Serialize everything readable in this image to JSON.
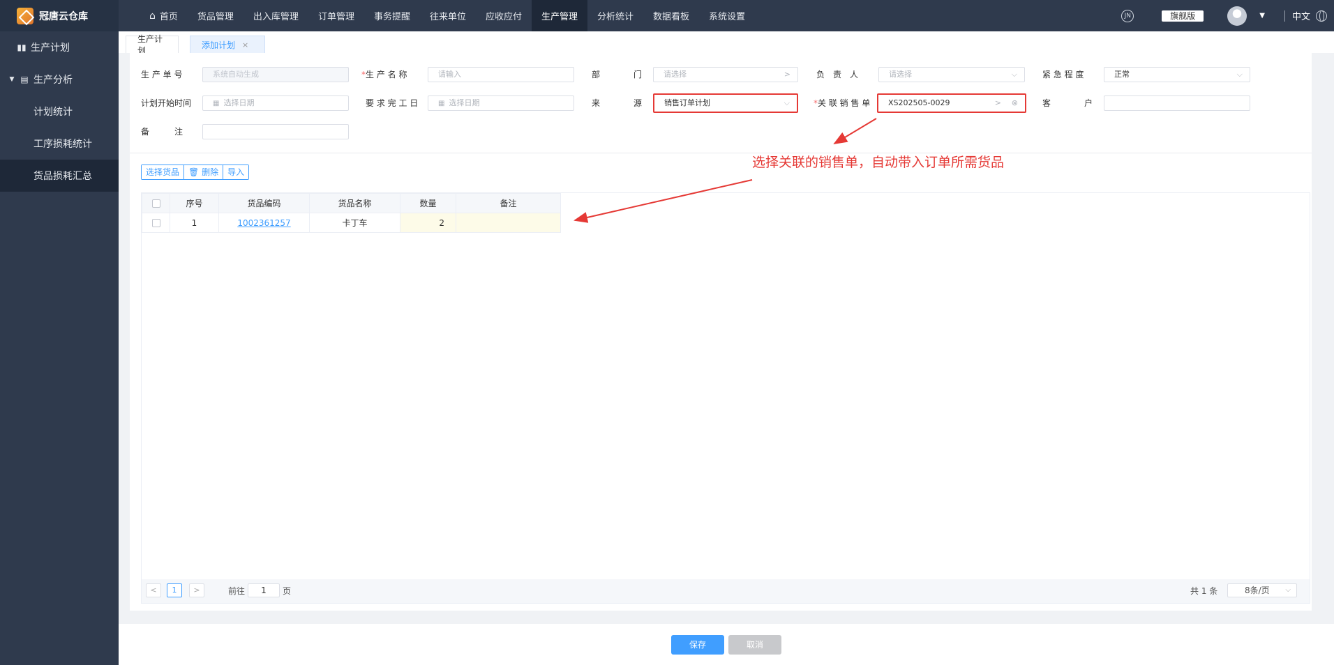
{
  "app": {
    "title": "冠唐云仓库"
  },
  "sidebar": {
    "items": [
      {
        "label": "生产计划"
      },
      {
        "label": "生产分析"
      },
      {
        "label": "计划统计"
      },
      {
        "label": "工序损耗统计"
      },
      {
        "label": "货品损耗汇总"
      }
    ]
  },
  "nav": {
    "items": [
      "首页",
      "货品管理",
      "出入库管理",
      "订单管理",
      "事务提醒",
      "往来单位",
      "应收应付",
      "生产管理",
      "分析统计",
      "数据看板",
      "系统设置"
    ],
    "active": "生产管理"
  },
  "topbar": {
    "edition": "旗舰版",
    "language": "中文"
  },
  "tabs": [
    {
      "label": "生产计划"
    },
    {
      "label": "添加计划",
      "close": "×"
    }
  ],
  "form": {
    "prod_no": {
      "label": "生 产 单 号",
      "placeholder": "系统自动生成"
    },
    "prod_name": {
      "required": "*",
      "label": "生 产 名 称",
      "placeholder": "请输入"
    },
    "department": {
      "label": "部　　　　门",
      "placeholder": "请选择",
      "arrow": ">"
    },
    "owner": {
      "label": "负　责　人",
      "placeholder": "请选择"
    },
    "urgency": {
      "label": "紧 急 程 度",
      "value": "正常"
    },
    "start_time": {
      "label": "计划开始时间",
      "placeholder": "选择日期"
    },
    "finish_date": {
      "label": "要 求 完 工 日",
      "placeholder": "选择日期"
    },
    "source": {
      "label": "来　　　　源",
      "value": "销售订单计划"
    },
    "sales_order": {
      "required": "*",
      "label": "关 联 销 售 单",
      "value": "XS202505-0029",
      "arrow": ">"
    },
    "customer": {
      "label": "客　　　　户",
      "value": ""
    },
    "remark": {
      "label": "备　　　注",
      "value": ""
    }
  },
  "toolbar": {
    "select_goods": "选择货品",
    "delete": "删除",
    "import": "导入"
  },
  "annotation": {
    "text": "选择关联的销售单，自动带入订单所需货品"
  },
  "table": {
    "headers": [
      "序号",
      "货品编码",
      "货品名称",
      "数量",
      "备注"
    ],
    "rows": [
      {
        "index": "1",
        "code": "1002361257",
        "name": "卡丁车",
        "qty": "2",
        "remark": ""
      }
    ]
  },
  "pager": {
    "current": "1",
    "goto_label": "前往",
    "goto_value": "1",
    "page_suffix": "页",
    "total": "共 1 条",
    "page_size": "8条/页"
  },
  "footer": {
    "save": "保存",
    "cancel": "取消"
  },
  "colors": {
    "sidebar_bg": "#2f3a4d",
    "accent": "#409eff",
    "annotation_red": "#e53935"
  }
}
